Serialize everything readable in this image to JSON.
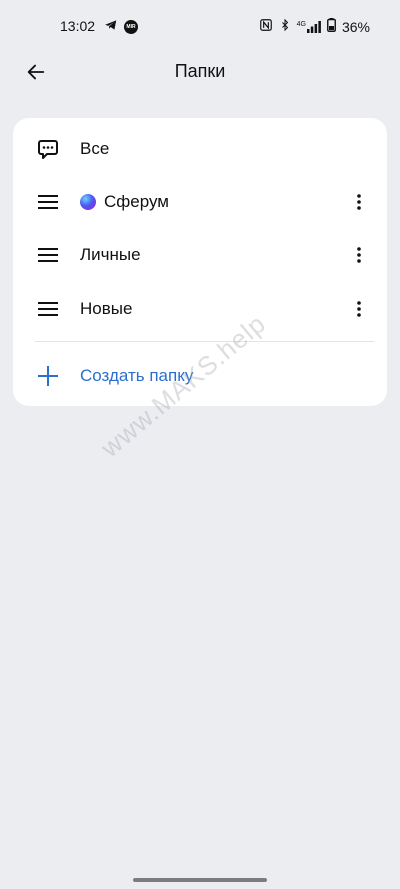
{
  "status_bar": {
    "time": "13:02",
    "icons_left": [
      "telegram-icon",
      "mts-badge-icon"
    ],
    "icons_right": [
      "nfc-icon",
      "bluetooth-icon",
      "signal-4g-icon",
      "battery-icon"
    ],
    "mts_badge": "MIR",
    "network": "4G",
    "battery": "36%"
  },
  "header": {
    "title": "Папки"
  },
  "folders": [
    {
      "label": "Все",
      "icon": "chat-icon",
      "has_menu": false
    },
    {
      "label": "Сферум",
      "icon": "drag-handle-icon",
      "has_menu": true,
      "logo": "sferum-logo"
    },
    {
      "label": "Личные",
      "icon": "drag-handle-icon",
      "has_menu": true
    },
    {
      "label": "Новые",
      "icon": "drag-handle-icon",
      "has_menu": true
    }
  ],
  "create_folder": {
    "label": "Создать папку",
    "icon": "plus-icon",
    "color": "#2a6fd0"
  },
  "watermark": "www.MAKS.help",
  "colors": {
    "background": "#ecedf1",
    "card": "#ffffff",
    "accent": "#2a6fd0"
  }
}
